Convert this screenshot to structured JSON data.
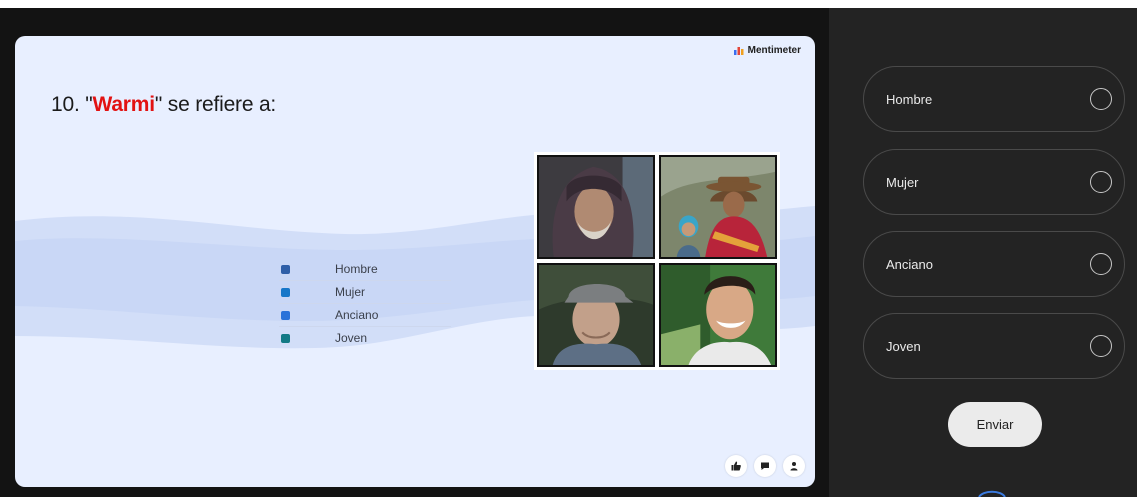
{
  "brand": {
    "name": "Mentimeter"
  },
  "question": {
    "prefix": "10. \"",
    "highlight": "Warmi",
    "suffix": "\" se refiere a:"
  },
  "legend": [
    {
      "label": "Hombre",
      "color": "#2f5fa8"
    },
    {
      "label": "Mujer",
      "color": "#1777c9"
    },
    {
      "label": "Anciano",
      "color": "#2a72d9"
    },
    {
      "label": "Joven",
      "color": "#137a86"
    }
  ],
  "options": [
    {
      "label": "Hombre"
    },
    {
      "label": "Mujer"
    },
    {
      "label": "Anciano"
    },
    {
      "label": "Joven"
    }
  ],
  "submit": {
    "label": "Enviar"
  },
  "reactions": [
    "thumbs-up-icon",
    "chat-bubble-icon",
    "person-icon"
  ]
}
